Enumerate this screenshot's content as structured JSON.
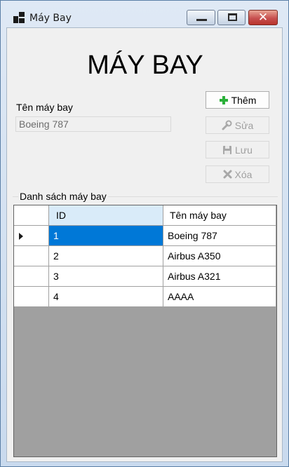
{
  "window": {
    "title": "Máy Bay"
  },
  "heading": "MÁY BAY",
  "form": {
    "name_label": "Tên máy bay",
    "name_value": "Boeing 787"
  },
  "buttons": {
    "add": "Thêm",
    "edit": "Sửa",
    "save": "Lưu",
    "delete": "Xóa"
  },
  "group_label": "Danh sách máy bay",
  "grid": {
    "columns": [
      "ID",
      "Tên máy bay"
    ],
    "rows": [
      {
        "id": "1",
        "name": "Boeing 787"
      },
      {
        "id": "2",
        "name": "Airbus A350"
      },
      {
        "id": "3",
        "name": "Airbus A321"
      },
      {
        "id": "4",
        "name": "AAAA"
      }
    ]
  },
  "colors": {
    "selected_cell": "#0078d7",
    "selected_header": "#d9ebf9",
    "grid_background": "#a0a0a0",
    "add_icon": "#2bb03a"
  }
}
